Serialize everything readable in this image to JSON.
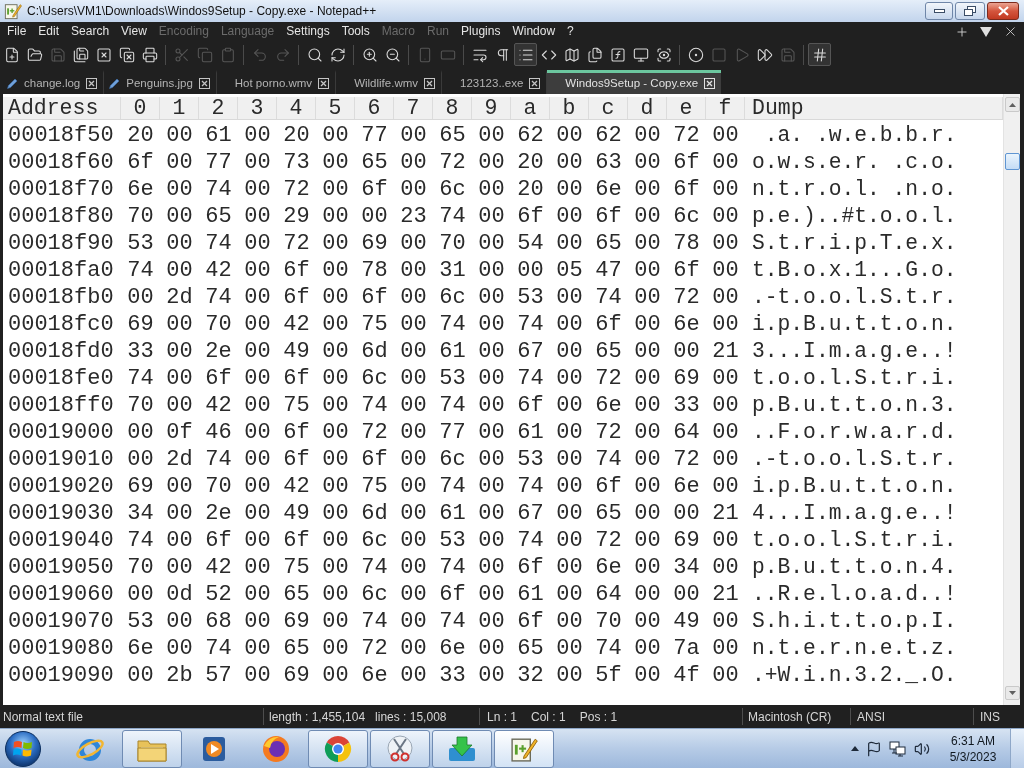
{
  "window": {
    "title": "C:\\Users\\VM1\\Downloads\\Windos9Setup - Copy.exe - Notepad++"
  },
  "menu": [
    {
      "label": "File",
      "disabled": false
    },
    {
      "label": "Edit",
      "disabled": false
    },
    {
      "label": "Search",
      "disabled": false
    },
    {
      "label": "View",
      "disabled": false
    },
    {
      "label": "Encoding",
      "disabled": true
    },
    {
      "label": "Language",
      "disabled": true
    },
    {
      "label": "Settings",
      "disabled": false
    },
    {
      "label": "Tools",
      "disabled": false
    },
    {
      "label": "Macro",
      "disabled": true
    },
    {
      "label": "Run",
      "disabled": true
    },
    {
      "label": "Plugins",
      "disabled": false
    },
    {
      "label": "Window",
      "disabled": false
    },
    {
      "label": "?",
      "disabled": false
    }
  ],
  "menu_controls": [
    {
      "kind": "add"
    },
    {
      "kind": "dropdown"
    },
    {
      "kind": "close"
    }
  ],
  "toolbar": [
    {
      "kind": "new",
      "disabled": false,
      "pressed": false
    },
    {
      "kind": "open",
      "disabled": false,
      "pressed": false
    },
    {
      "kind": "save",
      "disabled": true,
      "pressed": false
    },
    {
      "kind": "saveall",
      "disabled": false,
      "pressed": false
    },
    {
      "kind": "close",
      "disabled": false,
      "pressed": false
    },
    {
      "kind": "closeall",
      "disabled": false,
      "pressed": false
    },
    {
      "kind": "print",
      "disabled": false,
      "pressed": false
    },
    {
      "kind": "separator"
    },
    {
      "kind": "cut",
      "disabled": true,
      "pressed": false
    },
    {
      "kind": "copy",
      "disabled": true,
      "pressed": false
    },
    {
      "kind": "paste",
      "disabled": true,
      "pressed": false
    },
    {
      "kind": "separator"
    },
    {
      "kind": "undo",
      "disabled": true,
      "pressed": false
    },
    {
      "kind": "redo",
      "disabled": true,
      "pressed": false
    },
    {
      "kind": "separator"
    },
    {
      "kind": "find",
      "disabled": false,
      "pressed": false
    },
    {
      "kind": "replace",
      "disabled": false,
      "pressed": false
    },
    {
      "kind": "separator"
    },
    {
      "kind": "zoomin",
      "disabled": false,
      "pressed": false
    },
    {
      "kind": "zoomout",
      "disabled": false,
      "pressed": false
    },
    {
      "kind": "separator"
    },
    {
      "kind": "syncv",
      "disabled": true,
      "pressed": false
    },
    {
      "kind": "synch",
      "disabled": true,
      "pressed": false
    },
    {
      "kind": "separator"
    },
    {
      "kind": "wrap",
      "disabled": false,
      "pressed": false
    },
    {
      "kind": "allchars",
      "disabled": false,
      "pressed": false
    },
    {
      "kind": "indent",
      "disabled": false,
      "pressed": true
    },
    {
      "kind": "code",
      "disabled": false,
      "pressed": false
    },
    {
      "kind": "map",
      "disabled": false,
      "pressed": false
    },
    {
      "kind": "doclist",
      "disabled": false,
      "pressed": false
    },
    {
      "kind": "funclist",
      "disabled": false,
      "pressed": false
    },
    {
      "kind": "workspace",
      "disabled": false,
      "pressed": false
    },
    {
      "kind": "monitor",
      "disabled": false,
      "pressed": false
    },
    {
      "kind": "separator"
    },
    {
      "kind": "record",
      "disabled": false,
      "pressed": false
    },
    {
      "kind": "stop",
      "disabled": true,
      "pressed": false
    },
    {
      "kind": "play",
      "disabled": true,
      "pressed": false
    },
    {
      "kind": "playmulti",
      "disabled": false,
      "pressed": false
    },
    {
      "kind": "savemacro",
      "disabled": true,
      "pressed": false
    },
    {
      "kind": "separator"
    },
    {
      "kind": "hex",
      "disabled": false,
      "pressed": true
    }
  ],
  "tabs": [
    {
      "label": "change.log",
      "edited": true,
      "selected": false
    },
    {
      "label": "Penguins.jpg",
      "edited": true,
      "selected": false
    },
    {
      "label": "Hot porno.wmv",
      "edited": false,
      "selected": false
    },
    {
      "label": "Wildlife.wmv",
      "edited": false,
      "selected": false
    },
    {
      "label": "123123..exe",
      "edited": false,
      "selected": false
    },
    {
      "label": "Windos9Setup - Copy.exe",
      "edited": false,
      "selected": true
    }
  ],
  "hex_view": {
    "columns": [
      "Address",
      "0",
      "1",
      "2",
      "3",
      "4",
      "5",
      "6",
      "7",
      "8",
      "9",
      "a",
      "b",
      "c",
      "d",
      "e",
      "f",
      "Dump"
    ],
    "rows": [
      {
        "address": "00018f50",
        "bytes": [
          "20",
          "00",
          "61",
          "00",
          "20",
          "00",
          "77",
          "00",
          "65",
          "00",
          "62",
          "00",
          "62",
          "00",
          "72",
          "00"
        ],
        "dump": " .a. .w.e.b.b.r."
      },
      {
        "address": "00018f60",
        "bytes": [
          "6f",
          "00",
          "77",
          "00",
          "73",
          "00",
          "65",
          "00",
          "72",
          "00",
          "20",
          "00",
          "63",
          "00",
          "6f",
          "00"
        ],
        "dump": "o.w.s.e.r. .c.o."
      },
      {
        "address": "00018f70",
        "bytes": [
          "6e",
          "00",
          "74",
          "00",
          "72",
          "00",
          "6f",
          "00",
          "6c",
          "00",
          "20",
          "00",
          "6e",
          "00",
          "6f",
          "00"
        ],
        "dump": "n.t.r.o.l. .n.o."
      },
      {
        "address": "00018f80",
        "bytes": [
          "70",
          "00",
          "65",
          "00",
          "29",
          "00",
          "00",
          "23",
          "74",
          "00",
          "6f",
          "00",
          "6f",
          "00",
          "6c",
          "00"
        ],
        "dump": "p.e.)..#t.o.o.l."
      },
      {
        "address": "00018f90",
        "bytes": [
          "53",
          "00",
          "74",
          "00",
          "72",
          "00",
          "69",
          "00",
          "70",
          "00",
          "54",
          "00",
          "65",
          "00",
          "78",
          "00"
        ],
        "dump": "S.t.r.i.p.T.e.x."
      },
      {
        "address": "00018fa0",
        "bytes": [
          "74",
          "00",
          "42",
          "00",
          "6f",
          "00",
          "78",
          "00",
          "31",
          "00",
          "00",
          "05",
          "47",
          "00",
          "6f",
          "00"
        ],
        "dump": "t.B.o.x.1...G.o."
      },
      {
        "address": "00018fb0",
        "bytes": [
          "00",
          "2d",
          "74",
          "00",
          "6f",
          "00",
          "6f",
          "00",
          "6c",
          "00",
          "53",
          "00",
          "74",
          "00",
          "72",
          "00"
        ],
        "dump": ".-t.o.o.l.S.t.r."
      },
      {
        "address": "00018fc0",
        "bytes": [
          "69",
          "00",
          "70",
          "00",
          "42",
          "00",
          "75",
          "00",
          "74",
          "00",
          "74",
          "00",
          "6f",
          "00",
          "6e",
          "00"
        ],
        "dump": "i.p.B.u.t.t.o.n."
      },
      {
        "address": "00018fd0",
        "bytes": [
          "33",
          "00",
          "2e",
          "00",
          "49",
          "00",
          "6d",
          "00",
          "61",
          "00",
          "67",
          "00",
          "65",
          "00",
          "00",
          "21"
        ],
        "dump": "3...I.m.a.g.e..!"
      },
      {
        "address": "00018fe0",
        "bytes": [
          "74",
          "00",
          "6f",
          "00",
          "6f",
          "00",
          "6c",
          "00",
          "53",
          "00",
          "74",
          "00",
          "72",
          "00",
          "69",
          "00"
        ],
        "dump": "t.o.o.l.S.t.r.i."
      },
      {
        "address": "00018ff0",
        "bytes": [
          "70",
          "00",
          "42",
          "00",
          "75",
          "00",
          "74",
          "00",
          "74",
          "00",
          "6f",
          "00",
          "6e",
          "00",
          "33",
          "00"
        ],
        "dump": "p.B.u.t.t.o.n.3."
      },
      {
        "address": "00019000",
        "bytes": [
          "00",
          "0f",
          "46",
          "00",
          "6f",
          "00",
          "72",
          "00",
          "77",
          "00",
          "61",
          "00",
          "72",
          "00",
          "64",
          "00"
        ],
        "dump": "..F.o.r.w.a.r.d."
      },
      {
        "address": "00019010",
        "bytes": [
          "00",
          "2d",
          "74",
          "00",
          "6f",
          "00",
          "6f",
          "00",
          "6c",
          "00",
          "53",
          "00",
          "74",
          "00",
          "72",
          "00"
        ],
        "dump": ".-t.o.o.l.S.t.r."
      },
      {
        "address": "00019020",
        "bytes": [
          "69",
          "00",
          "70",
          "00",
          "42",
          "00",
          "75",
          "00",
          "74",
          "00",
          "74",
          "00",
          "6f",
          "00",
          "6e",
          "00"
        ],
        "dump": "i.p.B.u.t.t.o.n."
      },
      {
        "address": "00019030",
        "bytes": [
          "34",
          "00",
          "2e",
          "00",
          "49",
          "00",
          "6d",
          "00",
          "61",
          "00",
          "67",
          "00",
          "65",
          "00",
          "00",
          "21"
        ],
        "dump": "4...I.m.a.g.e..!"
      },
      {
        "address": "00019040",
        "bytes": [
          "74",
          "00",
          "6f",
          "00",
          "6f",
          "00",
          "6c",
          "00",
          "53",
          "00",
          "74",
          "00",
          "72",
          "00",
          "69",
          "00"
        ],
        "dump": "t.o.o.l.S.t.r.i."
      },
      {
        "address": "00019050",
        "bytes": [
          "70",
          "00",
          "42",
          "00",
          "75",
          "00",
          "74",
          "00",
          "74",
          "00",
          "6f",
          "00",
          "6e",
          "00",
          "34",
          "00"
        ],
        "dump": "p.B.u.t.t.o.n.4."
      },
      {
        "address": "00019060",
        "bytes": [
          "00",
          "0d",
          "52",
          "00",
          "65",
          "00",
          "6c",
          "00",
          "6f",
          "00",
          "61",
          "00",
          "64",
          "00",
          "00",
          "21"
        ],
        "dump": "..R.e.l.o.a.d..!"
      },
      {
        "address": "00019070",
        "bytes": [
          "53",
          "00",
          "68",
          "00",
          "69",
          "00",
          "74",
          "00",
          "74",
          "00",
          "6f",
          "00",
          "70",
          "00",
          "49",
          "00"
        ],
        "dump": "S.h.i.t.t.o.p.I."
      },
      {
        "address": "00019080",
        "bytes": [
          "6e",
          "00",
          "74",
          "00",
          "65",
          "00",
          "72",
          "00",
          "6e",
          "00",
          "65",
          "00",
          "74",
          "00",
          "7a",
          "00"
        ],
        "dump": "n.t.e.r.n.e.t.z."
      },
      {
        "address": "00019090",
        "bytes": [
          "00",
          "2b",
          "57",
          "00",
          "69",
          "00",
          "6e",
          "00",
          "33",
          "00",
          "32",
          "00",
          "5f",
          "00",
          "4f",
          "00"
        ],
        "dump": ".+W.i.n.3.2._.O."
      }
    ]
  },
  "status_bar": {
    "doc_type": "Normal text file",
    "length": "length : 1,455,104",
    "lines": "lines : 15,008",
    "ln": "Ln : 1",
    "col": "Col : 1",
    "pos": "Pos : 1",
    "eol": "Macintosh (CR)",
    "encoding": "ANSI",
    "mode": "INS"
  },
  "taskbar": {
    "apps": [
      {
        "kind": "ebrowser",
        "running": false,
        "active": false
      },
      {
        "kind": "folder",
        "running": true,
        "active": false
      },
      {
        "kind": "player",
        "running": false,
        "active": false
      },
      {
        "kind": "foxbrowser",
        "running": false,
        "active": false
      },
      {
        "kind": "circlebrowser",
        "running": true,
        "active": false
      },
      {
        "kind": "scissors",
        "running": true,
        "active": false
      },
      {
        "kind": "download",
        "running": true,
        "active": false
      },
      {
        "kind": "notepad",
        "running": true,
        "active": true
      }
    ],
    "tray": [
      {
        "kind": "chevron"
      },
      {
        "kind": "flag"
      },
      {
        "kind": "network"
      },
      {
        "kind": "volume"
      }
    ],
    "clock": {
      "time": "6:31 AM",
      "date": "5/3/2023"
    }
  }
}
